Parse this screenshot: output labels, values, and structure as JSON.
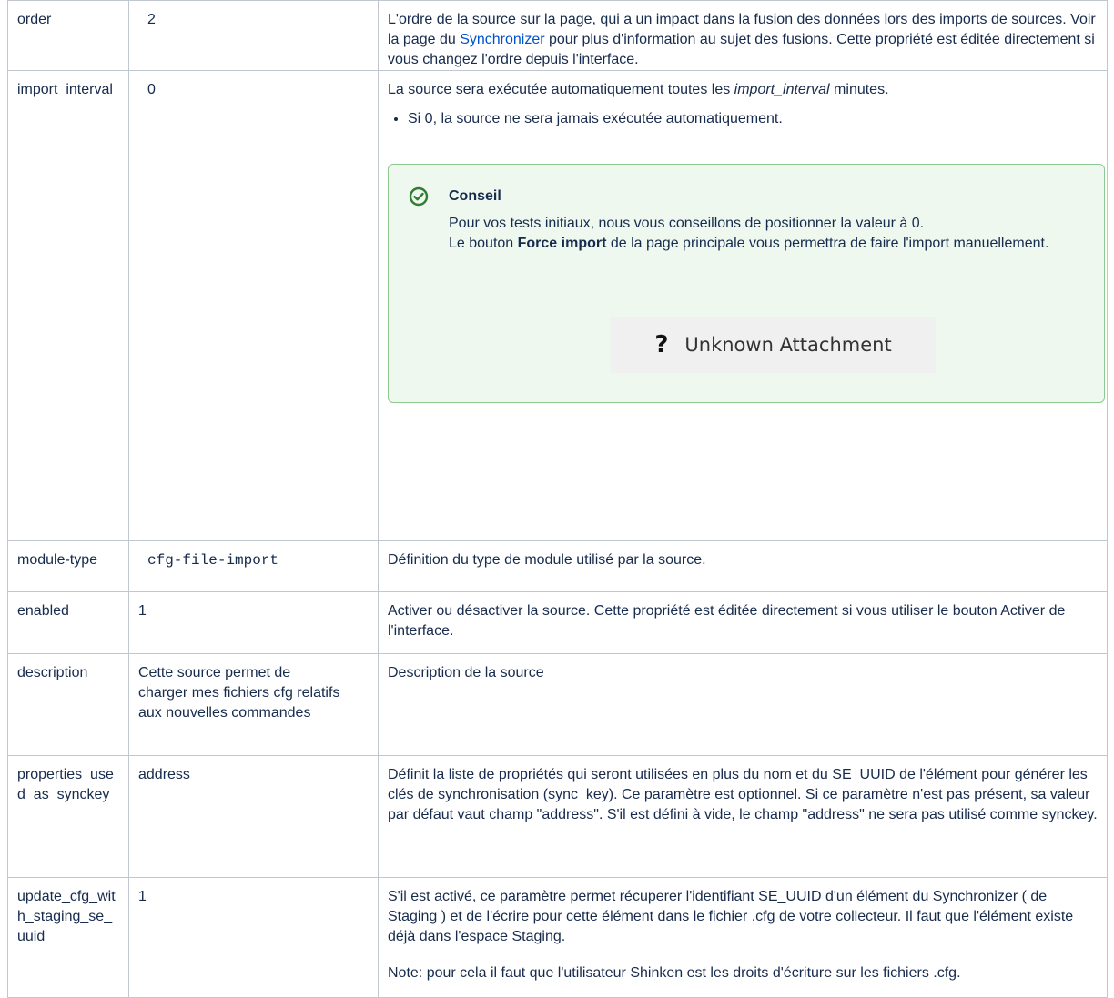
{
  "rows": [
    {
      "name": "order",
      "value": "2",
      "desc_before": "L'ordre de la source sur la page, qui a un impact dans la fusion des données lors des imports de sources. Voir la page du ",
      "desc_link": "Synchronizer",
      "desc_after": " pour plus d'information au sujet des fusions. Cette propriété est éditée directement si vous changez l'ordre depuis l'interface."
    },
    {
      "name": "import_interval",
      "value": "0",
      "desc_before": "La source sera exécutée automatiquement toutes les ",
      "desc_em": "import_interval",
      "desc_after": " minutes.",
      "bullet": "Si 0, la source ne sera jamais exécutée automatiquement.",
      "tip": {
        "title": "Conseil",
        "line1": "Pour vos tests initiaux, nous vous conseillons de positionner la valeur à 0.",
        "line2_before": "Le bouton ",
        "line2_bold": "Force import",
        "line2_after": " de la page principale vous permettra de faire l'import manuellement.",
        "attachment_icon": "?",
        "attachment_label": "Unknown Attachment"
      }
    },
    {
      "name": "module-type",
      "value": "cfg-file-import",
      "desc": "Définition du type de module utilisé par la source."
    },
    {
      "name": "enabled",
      "value": "1",
      "desc": "Activer ou désactiver la source. Cette propriété est éditée directement si vous utiliser le bouton Activer de l'interface."
    },
    {
      "name": "description",
      "value": "Cette source permet de charger mes fichiers cfg relatifs aux nouvelles commandes",
      "desc": "Description de la source"
    },
    {
      "name": "properties_used_as_synckey",
      "value": "address",
      "desc": "Définit la liste de propriétés qui seront utilisées en plus du nom et du SE_UUID de l'élément pour générer les clés de synchronisation (sync_key). Ce paramètre est optionnel. Si ce paramètre n'est pas présent, sa valeur par défaut vaut champ \"address\". S'il est défini à vide, le champ \"address\" ne sera pas utilisé comme synckey."
    },
    {
      "name": "update_cfg_with_staging_se_uuid",
      "value": "1",
      "desc": "S'il est activé, ce paramètre permet récuperer l'identifiant SE_UUID d'un élément du Synchronizer ( de Staging ) et de l'écrire pour cette élément dans le fichier .cfg de votre collecteur. Il faut que l'élément existe déjà dans l'espace Staging.",
      "note": "Note: pour cela il faut que l'utilisateur Shinken est les droits d'écriture sur les fichiers .cfg."
    }
  ],
  "colors": {
    "link": "#0052cc",
    "tip_bg": "#eef8ef",
    "tip_border": "#8cc98f",
    "tip_icon": "#2e7d32",
    "border": "#c1c7d0"
  }
}
